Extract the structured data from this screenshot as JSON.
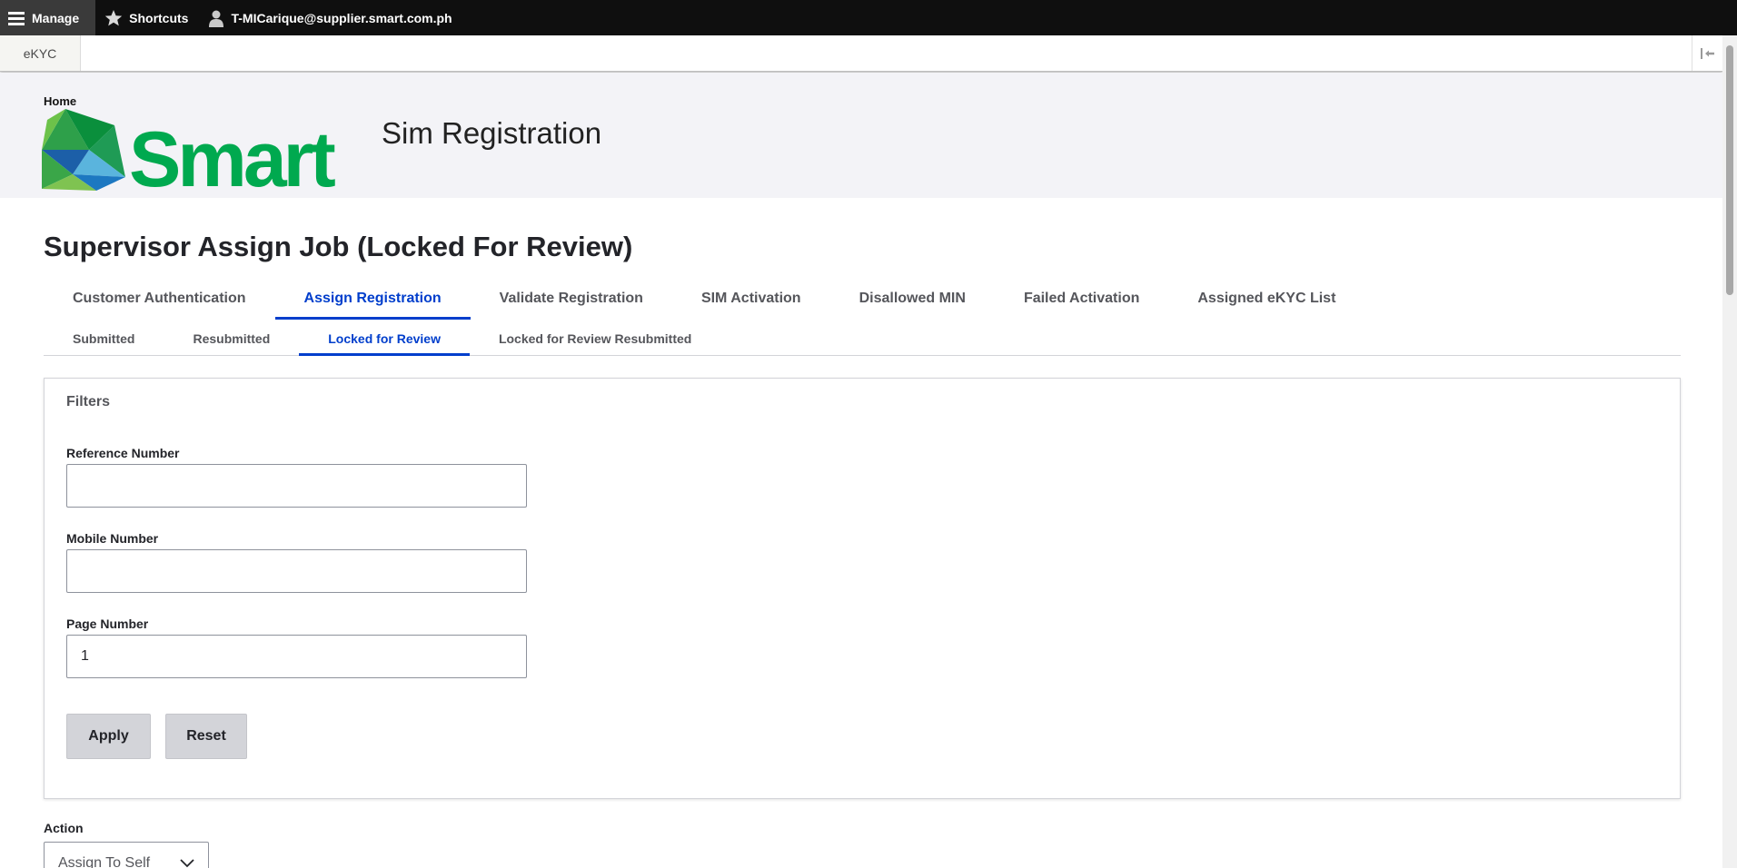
{
  "toolbar": {
    "manage_label": "Manage",
    "shortcuts_label": "Shortcuts",
    "user_label": "T-MICarique@supplier.smart.com.ph"
  },
  "tray": {
    "tab_label": "eKYC"
  },
  "header": {
    "home_link": "Home",
    "logo_text": "Smart",
    "site_name": "Sim Registration"
  },
  "page": {
    "title": "Supervisor Assign Job (Locked For Review)"
  },
  "primary_tabs": [
    {
      "label": "Customer Authentication"
    },
    {
      "label": "Assign Registration"
    },
    {
      "label": "Validate Registration"
    },
    {
      "label": "SIM Activation"
    },
    {
      "label": "Disallowed MIN"
    },
    {
      "label": "Failed Activation"
    },
    {
      "label": "Assigned eKYC List"
    }
  ],
  "secondary_tabs": [
    {
      "label": "Submitted"
    },
    {
      "label": "Resubmitted"
    },
    {
      "label": "Locked for Review"
    },
    {
      "label": "Locked for Review Resubmitted"
    }
  ],
  "filters": {
    "legend": "Filters",
    "reference_label": "Reference Number",
    "reference_value": "",
    "mobile_label": "Mobile Number",
    "mobile_value": "",
    "page_label": "Page Number",
    "page_value": "1",
    "apply_label": "Apply",
    "reset_label": "Reset"
  },
  "action": {
    "label": "Action",
    "selected": "Assign To Self"
  },
  "colors": {
    "accent": "#003ecc",
    "toolbar_bg": "#0f0f0f",
    "header_bg": "#f3f3f7",
    "logo_green": "#00a94f"
  }
}
